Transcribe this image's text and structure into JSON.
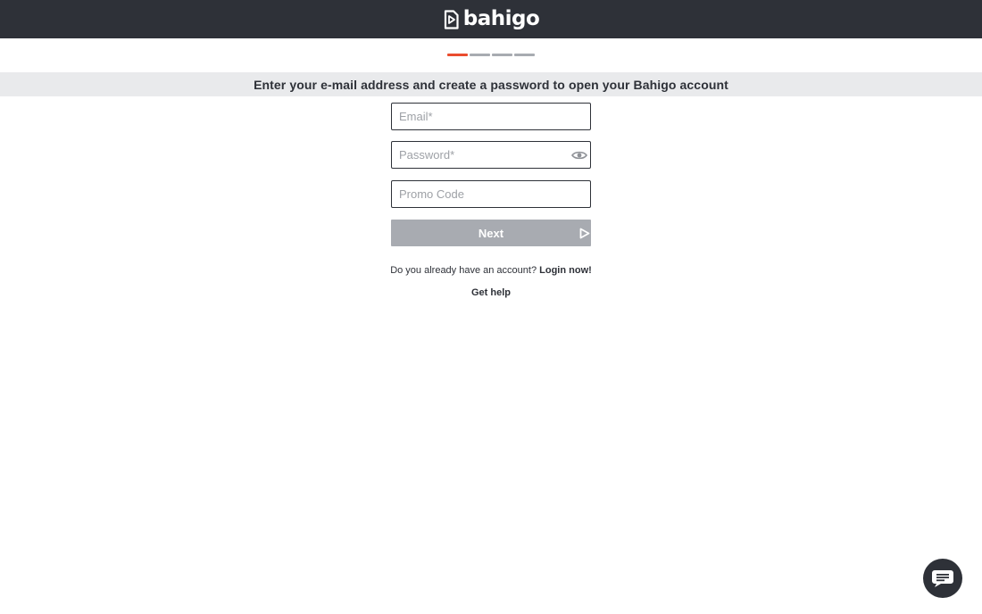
{
  "header": {
    "logo_text": "bahigo",
    "background_color": "#2e3138"
  },
  "progress": {
    "current_step": 1,
    "total_steps": 4,
    "active_color": "#ea4c2e",
    "inactive_color": "#a8abb1"
  },
  "instruction": "Enter your e-mail address and create a password to open your Bahigo account",
  "form": {
    "email_placeholder": "Email*",
    "email_value": "",
    "password_placeholder": "Password*",
    "password_value": "",
    "password_toggle_icon": "eye-icon",
    "promo_placeholder": "Promo Code",
    "promo_value": "",
    "next_label": "Next",
    "next_icon": "play-arrow-icon"
  },
  "footer": {
    "login_prompt": "Do you already have an account?",
    "login_link": "Login now!",
    "help_link": "Get help"
  },
  "chat": {
    "icon": "chat-bubble-icon"
  }
}
